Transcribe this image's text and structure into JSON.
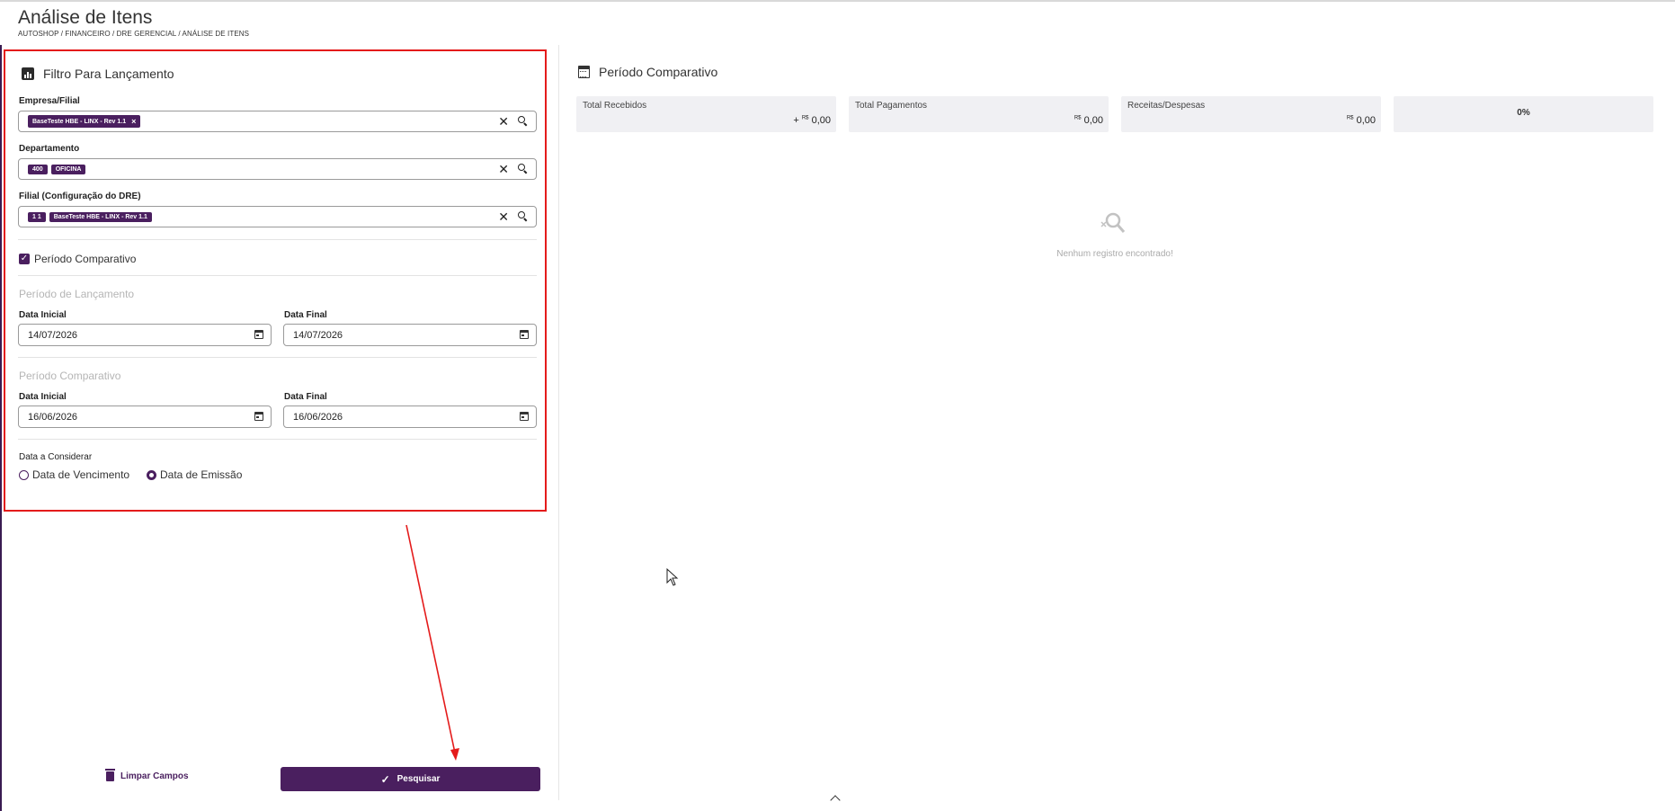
{
  "page": {
    "title": "Análise de Itens",
    "breadcrumb": "AUTOSHOP / FINANCEIRO / DRE GERENCIAL / ANÁLISE DE ITENS"
  },
  "filter": {
    "heading": "Filtro Para Lançamento",
    "empresa": {
      "label": "Empresa/Filial",
      "tags": [
        "BaseTeste HBE - LINX - Rev 1.1"
      ]
    },
    "departamento": {
      "label": "Departamento",
      "tags": [
        "400",
        "OFICINA"
      ]
    },
    "filial_dre": {
      "label": "Filial (Configuração do DRE)",
      "tags": [
        "1 1",
        "BaseTeste HBE - LINX - Rev 1.1"
      ]
    },
    "periodo_comparativo_checkbox": {
      "label": "Período Comparativo",
      "checked": true
    },
    "periodo_lancamento": {
      "heading": "Período de Lançamento",
      "data_inicial_label": "Data Inicial",
      "data_inicial": "14/07/2026",
      "data_final_label": "Data Final",
      "data_final": "14/07/2026"
    },
    "periodo_comparativo": {
      "heading": "Período Comparativo",
      "data_inicial_label": "Data Inicial",
      "data_inicial": "16/06/2026",
      "data_final_label": "Data Final",
      "data_final": "16/06/2026"
    },
    "data_considerar": {
      "label": "Data a Considerar",
      "options": [
        "Data de Vencimento",
        "Data de Emissão"
      ],
      "selected": "Data de Emissão"
    },
    "clear_label": "Limpar Campos",
    "search_label": "Pesquisar"
  },
  "comparative": {
    "heading": "Período Comparativo",
    "cards": [
      {
        "title": "Total Recebidos",
        "prefix": "+",
        "currency": "R$",
        "value": "0,00"
      },
      {
        "title": "Total Pagamentos",
        "currency": "R$",
        "value": "0,00"
      },
      {
        "title": "Receitas/Despesas",
        "currency": "R$",
        "value": "0,00"
      },
      {
        "center": "0%"
      }
    ],
    "empty_message": "Nenhum registro encontrado!"
  },
  "colors": {
    "brand": "#4a1f5f",
    "annotation": "#e41b1b"
  }
}
